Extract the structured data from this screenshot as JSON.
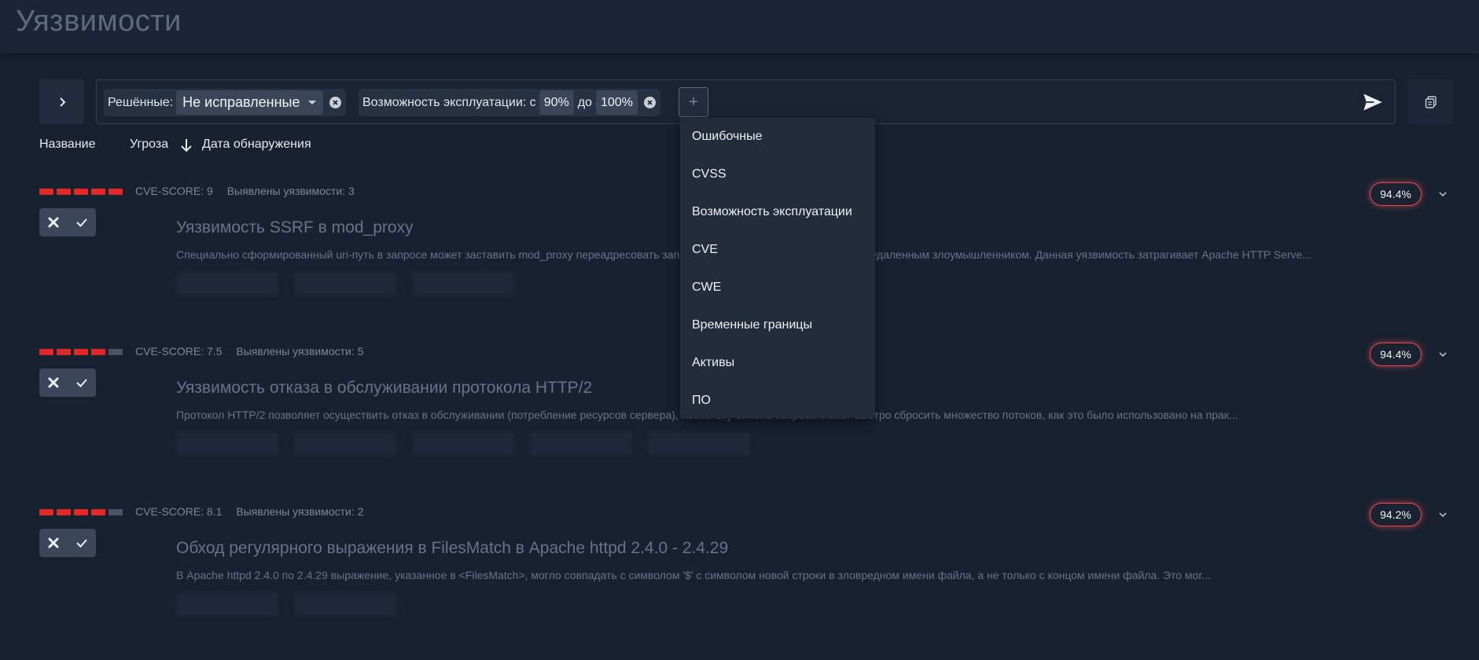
{
  "page": {
    "title": "Уязвимости"
  },
  "filters": {
    "resolved": {
      "label": "Решённые:",
      "value": "Не исправленные"
    },
    "exploit": {
      "label": "Возможность эксплуатации: с",
      "from": "90%",
      "to_label": "до",
      "to": "100%"
    },
    "add_label": "+"
  },
  "sort": {
    "name": "Название",
    "threat": "Угроза",
    "date": "Дата обнаружения"
  },
  "dropdown": {
    "items": [
      "Ошибочные",
      "CVSS",
      "Возможность эксплуатации",
      "CVE",
      "CWE",
      "Временные границы",
      "Активы",
      "ПО"
    ]
  },
  "cards": [
    {
      "level": 5,
      "cve_score": "CVE-SCORE: 9",
      "found": "Выявлены уязвимости: 3",
      "title": "Уязвимость SSRF в mod_proxy",
      "description": "Специально сформированный uri-путь в запросе может заставить mod_proxy переадресовать запрос на исходный сервер, выбранный удаленным злоумышленником. Данная уязвимость затрагивает Apache HTTP Serve...",
      "score": "94.4%",
      "tags": 3
    },
    {
      "level": 4,
      "cve_score": "CVE-SCORE: 7.5",
      "found": "Выявлены уязвимости: 5",
      "title": "Уязвимость отказа в обслуживании протокола HTTP/2",
      "description": "Протокол HTTP/2 позволяет осуществить отказ в обслуживании (потребление ресурсов сервера), поскольку отмена запроса может быстро сбросить множество потоков, как это было использовано на прак...",
      "score": "94.4%",
      "tags": 5
    },
    {
      "level": 4,
      "cve_score": "CVE-SCORE: 8.1",
      "found": "Выявлены уязвимости: 2",
      "title": "Обход регулярного выражения в FilesMatch в Apache httpd 2.4.0 - 2.4.29",
      "description": "В Apache httpd 2.4.0 по 2.4.29 выражение, указанное в <FilesMatch>, могло совпадать с символом '$' с символом новой строки в зловредном имени файла, а не только с концом имени файла. Это мог...",
      "score": "94.2%",
      "tags": 2
    }
  ],
  "colors": {
    "severity_on": "#e02a2a",
    "severity_off": "#4a5466",
    "score_border": "#e5484d"
  }
}
